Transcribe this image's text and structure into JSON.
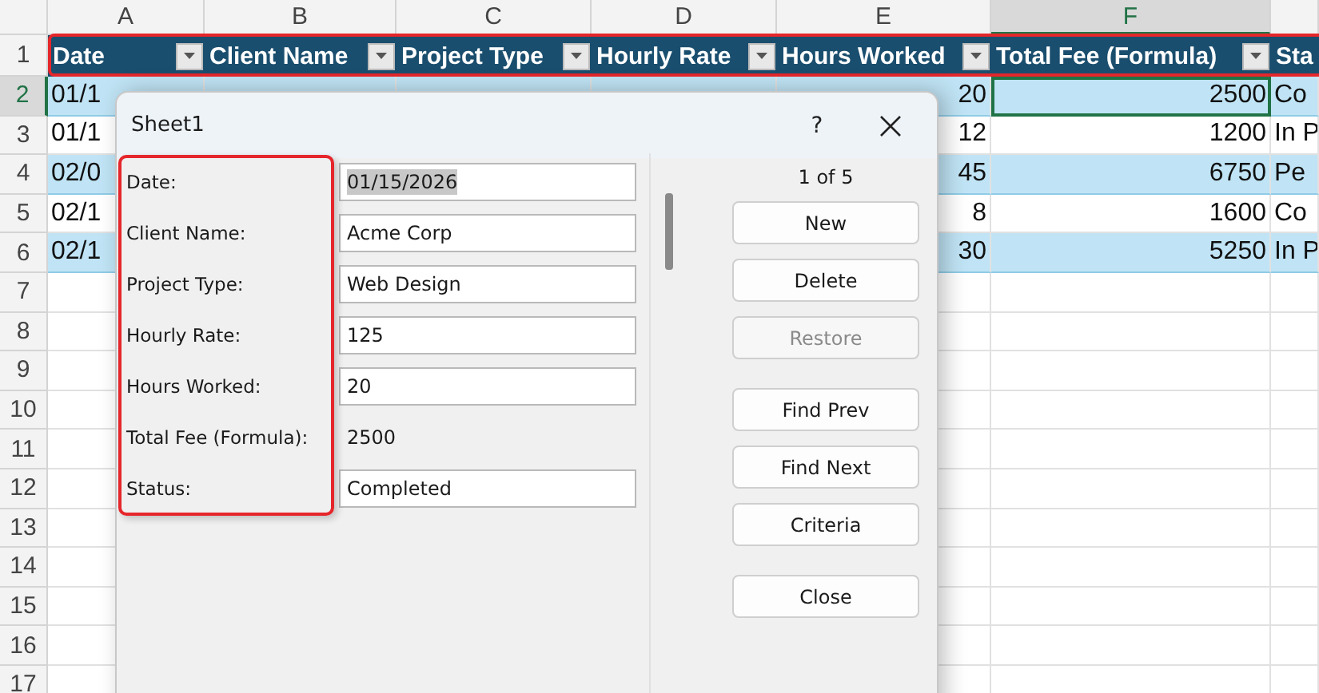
{
  "sheet": {
    "columns": [
      {
        "label": "A",
        "selected": false
      },
      {
        "label": "B",
        "selected": false
      },
      {
        "label": "C",
        "selected": false
      },
      {
        "label": "D",
        "selected": false
      },
      {
        "label": "E",
        "selected": false
      },
      {
        "label": "F",
        "selected": true
      }
    ],
    "row_numbers": [
      {
        "label": "1",
        "selected": false
      },
      {
        "label": "2",
        "selected": true
      },
      {
        "label": "3",
        "selected": false
      },
      {
        "label": "4",
        "selected": false
      },
      {
        "label": "5",
        "selected": false
      },
      {
        "label": "6",
        "selected": false
      },
      {
        "label": "7",
        "selected": false
      },
      {
        "label": "8",
        "selected": false
      },
      {
        "label": "9",
        "selected": false
      },
      {
        "label": "10",
        "selected": false
      },
      {
        "label": "11",
        "selected": false
      },
      {
        "label": "12",
        "selected": false
      },
      {
        "label": "13",
        "selected": false
      },
      {
        "label": "14",
        "selected": false
      },
      {
        "label": "15",
        "selected": false
      },
      {
        "label": "16",
        "selected": false
      },
      {
        "label": "17",
        "selected": false
      }
    ],
    "header": {
      "highlighted": true,
      "cells": [
        {
          "label": "Date",
          "filter": true
        },
        {
          "label": "Client Name",
          "filter": true
        },
        {
          "label": "Project Type",
          "filter": true
        },
        {
          "label": "Hourly Rate",
          "filter": true
        },
        {
          "label": "Hours Worked",
          "filter": true
        },
        {
          "label": "Total Fee (Formula)",
          "filter": true
        },
        {
          "label": "Sta",
          "filter": false
        }
      ]
    },
    "rows": [
      {
        "banded": true,
        "date": "01/1",
        "hours": "20",
        "fee": "2500",
        "fee_selected": true,
        "status": "Co"
      },
      {
        "banded": false,
        "date": "01/1",
        "hours": "12",
        "fee": "1200",
        "fee_selected": false,
        "status": "In P"
      },
      {
        "banded": true,
        "date": "02/0",
        "hours": "45",
        "fee": "6750",
        "fee_selected": false,
        "status": "Pe"
      },
      {
        "banded": false,
        "date": "02/1",
        "hours": "8",
        "fee": "1600",
        "fee_selected": false,
        "status": "Co"
      },
      {
        "banded": true,
        "date": "02/1",
        "hours": "30",
        "fee": "5250",
        "fee_selected": false,
        "status": "In P"
      }
    ]
  },
  "dialog": {
    "title": "Sheet1",
    "help": "?",
    "labels_highlighted": true,
    "fields": [
      {
        "label": "Date:",
        "kind": "input",
        "value": "01/15/2026",
        "selected": true
      },
      {
        "label": "Client Name:",
        "kind": "input",
        "value": "Acme Corp",
        "selected": false
      },
      {
        "label": "Project Type:",
        "kind": "input",
        "value": "Web Design",
        "selected": false
      },
      {
        "label": "Hourly Rate:",
        "kind": "input",
        "value": "125",
        "selected": false
      },
      {
        "label": "Hours Worked:",
        "kind": "input",
        "value": "20",
        "selected": false
      },
      {
        "label": "Total Fee (Formula):",
        "kind": "text",
        "value": "2500",
        "selected": false
      },
      {
        "label": "Status:",
        "kind": "input",
        "value": "Completed",
        "selected": false
      }
    ],
    "record": "1 of 5",
    "button_groups": [
      [
        {
          "label": "New",
          "disabled": false
        },
        {
          "label": "Delete",
          "disabled": false
        },
        {
          "label": "Restore",
          "disabled": true
        }
      ],
      [
        {
          "label": "Find Prev",
          "disabled": false
        },
        {
          "label": "Find Next",
          "disabled": false
        },
        {
          "label": "Criteria",
          "disabled": false
        }
      ],
      [
        {
          "label": "Close",
          "disabled": false
        }
      ]
    ]
  }
}
